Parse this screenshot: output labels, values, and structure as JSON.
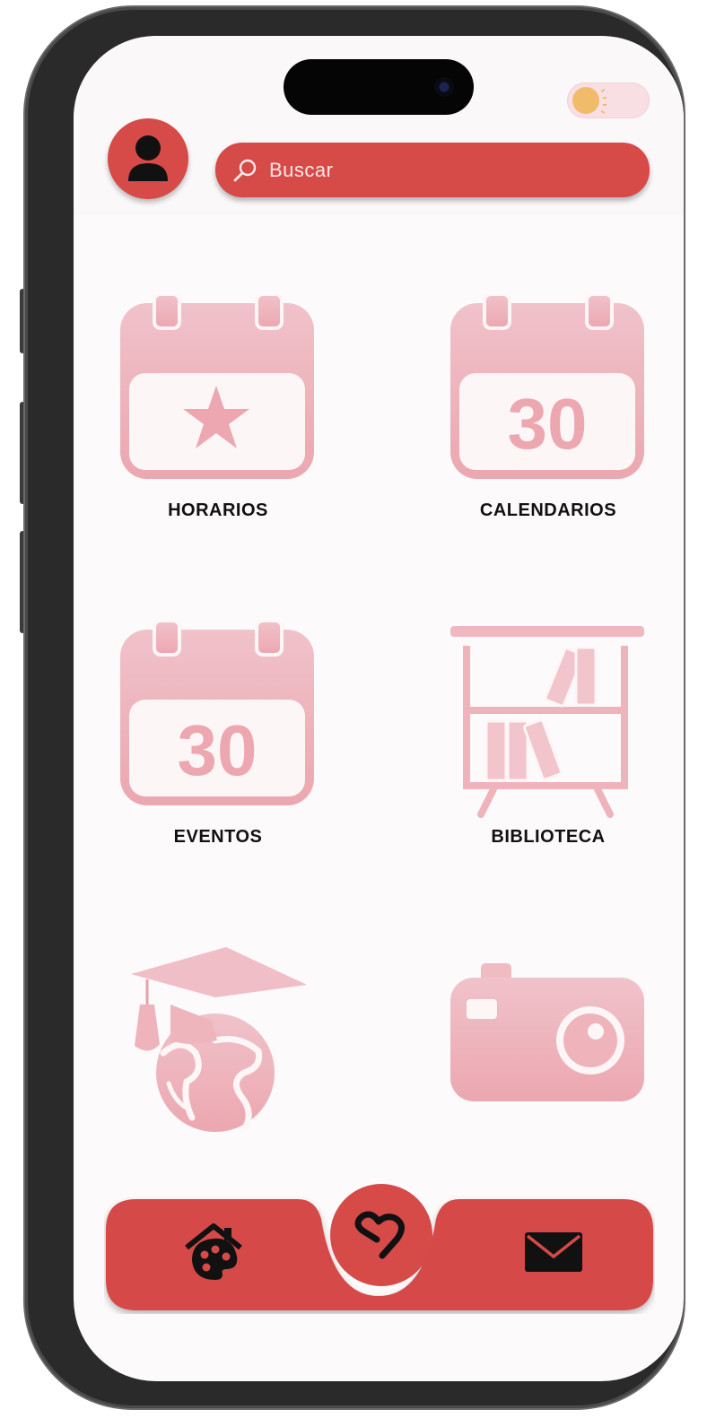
{
  "search": {
    "placeholder": "Buscar"
  },
  "menu": {
    "items": [
      {
        "label": "HORARIOS",
        "icon": "calendar-star-icon"
      },
      {
        "label": "CALENDARIOS",
        "icon": "calendar-30-icon",
        "number": "30"
      },
      {
        "label": "EVENTOS",
        "icon": "calendar-30-icon",
        "number": "30"
      },
      {
        "label": "BIBLIOTECA",
        "icon": "bookshelf-icon"
      },
      {
        "label": "",
        "icon": "graduation-globe-icon"
      },
      {
        "label": "",
        "icon": "camera-icon"
      }
    ]
  },
  "nav": {
    "left_icon": "home-palette-icon",
    "center_icon": "heart-logo-icon",
    "right_icon": "mail-icon"
  },
  "colors": {
    "accent": "#d64a48",
    "icon_pink_top": "#f0c2ca",
    "icon_pink_bottom": "#eca7b0",
    "background": "#fdfafb",
    "toggle_sun": "#f0bc6a"
  }
}
